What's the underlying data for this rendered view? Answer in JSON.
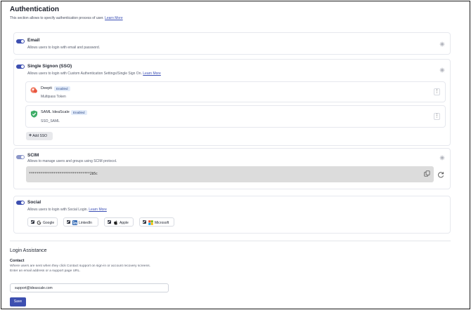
{
  "page": {
    "title": "Authentication",
    "intro": "This section allows to specify authentication process of user.",
    "learn_more": "Learn More"
  },
  "email": {
    "title": "Email",
    "description": "Allows users to login with email and password.",
    "enabled": true
  },
  "sso": {
    "title": "Single Signon (SSO)",
    "description": "Allows users to login with Custom Authentication Settings/Single Sign On.",
    "learn_more": "Learn More",
    "enabled": true,
    "providers": [
      {
        "name": "Deepti",
        "status": "Enabled",
        "type": "Multipass Token",
        "icon": "deepti-logo-icon"
      },
      {
        "name": "SAML IdeaScale",
        "status": "Enabled",
        "type": "SSO_SAML",
        "icon": "shield-check-icon"
      }
    ],
    "add_label": "Add SSO"
  },
  "scim": {
    "title": "SCIM",
    "description": "Allows to manage users and groups using SCIM protocol.",
    "enabled": true,
    "token": "********************************2b5c"
  },
  "social": {
    "title": "Social",
    "description": "Allows users to login with Social Login.",
    "learn_more": "Learn More",
    "enabled": true,
    "providers": [
      {
        "label": "Google",
        "checked": true,
        "icon": "google-icon"
      },
      {
        "label": "LinkedIn",
        "checked": true,
        "icon": "linkedin-icon"
      },
      {
        "label": "Apple",
        "checked": true,
        "icon": "apple-icon"
      },
      {
        "label": "Microsoft",
        "checked": true,
        "icon": "microsoft-icon"
      }
    ]
  },
  "login_assistance": {
    "title": "Login Assistance",
    "contact_title": "Contact",
    "contact_desc_1": "Where users are sent when they click Contact support on sign-in or account recovery screens.",
    "contact_desc_2": "Enter an email address or a support page URL.",
    "contact_value": "support@ideascale.com",
    "save_label": "Save"
  },
  "colors": {
    "accent": "#3d4fb0",
    "badge_bg": "#e3ecfa",
    "token_bg": "#dcdcdc"
  }
}
